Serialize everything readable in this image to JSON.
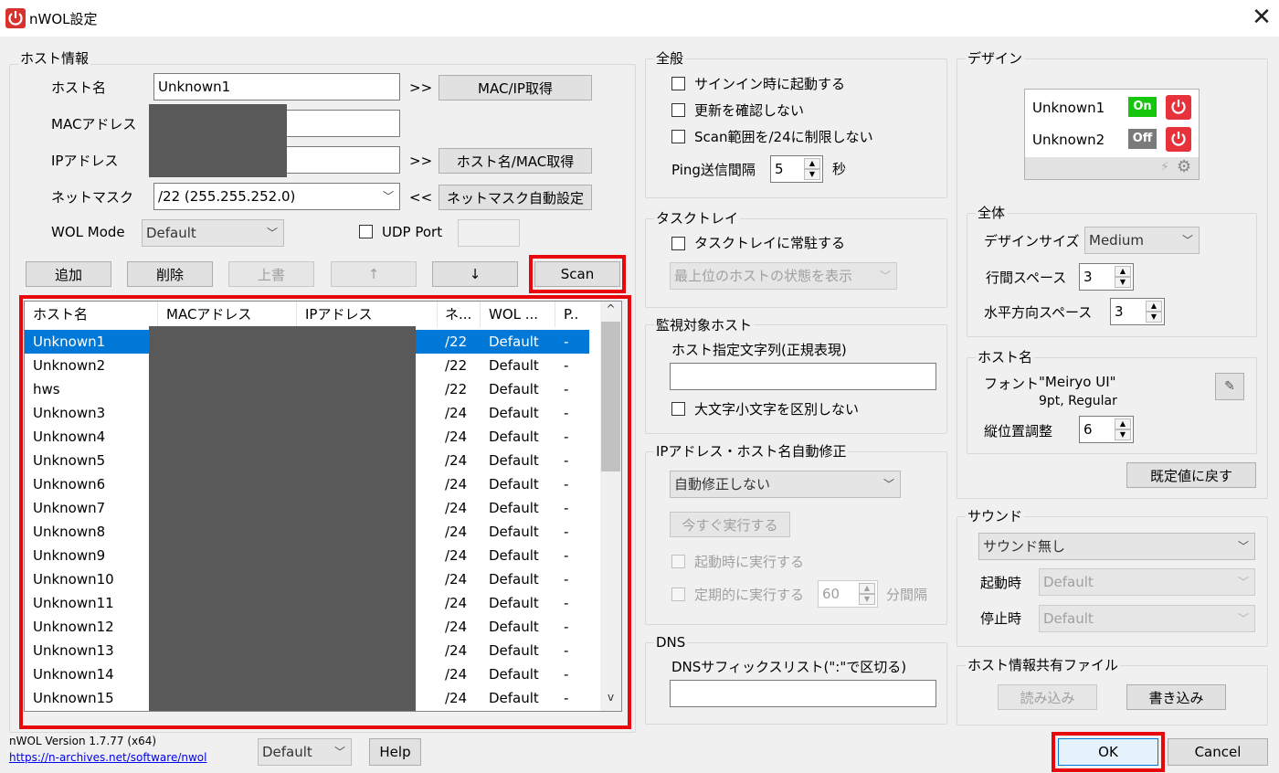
{
  "window": {
    "title": "nWOL設定",
    "close_icon": "close-icon"
  },
  "host_info": {
    "group_label": "ホスト情報",
    "hostname_label": "ホスト名",
    "hostname_value": "Unknown1",
    "arrow1": ">>",
    "mac_ip_button": "MAC/IP取得",
    "mac_label": "MACアドレス",
    "ip_label": "IPアドレス",
    "arrow2": ">>",
    "host_mac_button": "ホスト名/MAC取得",
    "netmask_label": "ネットマスク",
    "netmask_value": "/22 (255.255.252.0)",
    "arrow3": "<<",
    "netmask_auto_button": "ネットマスク自動設定",
    "wol_mode_label": "WOL Mode",
    "wol_mode_value": "Default",
    "udp_port_label": "UDP Port",
    "add_button": "追加",
    "delete_button": "削除",
    "overwrite_button": "上書",
    "up_button": "↑",
    "down_button": "↓",
    "scan_button": "Scan"
  },
  "host_list": {
    "columns": [
      "ホスト名",
      "MACアドレス",
      "IPアドレス",
      "ネ...",
      "WOL ...",
      "P.."
    ],
    "rows": [
      {
        "name": "Unknown1",
        "mask": "/22",
        "wol": "Default",
        "p": "-"
      },
      {
        "name": "Unknown2",
        "mask": "/22",
        "wol": "Default",
        "p": "-"
      },
      {
        "name": "hws",
        "mask": "/22",
        "wol": "Default",
        "p": "-"
      },
      {
        "name": "Unknown3",
        "mask": "/24",
        "wol": "Default",
        "p": "-"
      },
      {
        "name": "Unknown4",
        "mask": "/24",
        "wol": "Default",
        "p": "-"
      },
      {
        "name": "Unknown5",
        "mask": "/24",
        "wol": "Default",
        "p": "-"
      },
      {
        "name": "Unknown6",
        "mask": "/24",
        "wol": "Default",
        "p": "-"
      },
      {
        "name": "Unknown7",
        "mask": "/24",
        "wol": "Default",
        "p": "-"
      },
      {
        "name": "Unknown8",
        "mask": "/24",
        "wol": "Default",
        "p": "-"
      },
      {
        "name": "Unknown9",
        "mask": "/24",
        "wol": "Default",
        "p": "-"
      },
      {
        "name": "Unknown10",
        "mask": "/24",
        "wol": "Default",
        "p": "-"
      },
      {
        "name": "Unknown11",
        "mask": "/24",
        "wol": "Default",
        "p": "-"
      },
      {
        "name": "Unknown12",
        "mask": "/24",
        "wol": "Default",
        "p": "-"
      },
      {
        "name": "Unknown13",
        "mask": "/24",
        "wol": "Default",
        "p": "-"
      },
      {
        "name": "Unknown14",
        "mask": "/24",
        "wol": "Default",
        "p": "-"
      },
      {
        "name": "Unknown15",
        "mask": "/24",
        "wol": "Default",
        "p": "-"
      }
    ],
    "selected_index": 0,
    "scroll_up_icon": "^",
    "scroll_down_icon": "v"
  },
  "footer": {
    "version": "nWOL Version 1.7.77 (x64)",
    "url": "https://n-archives.net/software/nwol",
    "theme_value": "Default",
    "help_button": "Help",
    "ok_button": "OK",
    "cancel_button": "Cancel"
  },
  "general": {
    "group_label": "全般",
    "startup_label": "サインイン時に起動する",
    "no_update_label": "更新を確認しない",
    "scan_range_label": "Scan範囲を/24に制限しない",
    "ping_label": "Ping送信間隔",
    "ping_value": "5",
    "ping_unit": "秒"
  },
  "tray": {
    "group_label": "タスクトレイ",
    "resident_label": "タスクトレイに常駐する",
    "display_value": "最上位のホストの状態を表示"
  },
  "monitor": {
    "group_label": "監視対象ホスト",
    "pattern_label": "ホスト指定文字列(正規表現)",
    "pattern_value": "",
    "ignore_case_label": "大文字小文字を区別しない"
  },
  "autofix": {
    "group_label": "IPアドレス・ホスト名自動修正",
    "mode_value": "自動修正しない",
    "run_now_button": "今すぐ実行する",
    "run_at_start_label": "起動時に実行する",
    "periodic_label": "定期的に実行する",
    "interval_value": "60",
    "interval_unit": "分間隔"
  },
  "dns": {
    "group_label": "DNS",
    "suffix_label": "DNSサフィックスリスト(\":\"で区切る)",
    "suffix_value": ""
  },
  "design": {
    "group_label": "デザイン",
    "preview": [
      {
        "name": "Unknown1",
        "state": "On",
        "state_color": "#16c60c"
      },
      {
        "name": "Unknown2",
        "state": "Off",
        "state_color": "#7a7a7a"
      }
    ],
    "power_color": "#e8323b"
  },
  "overall": {
    "group_label": "全体",
    "size_label": "デザインサイズ",
    "size_value": "Medium",
    "line_space_label": "行間スペース",
    "line_space_value": "3",
    "h_space_label": "水平方向スペース",
    "h_space_value": "3"
  },
  "hostname_style": {
    "group_label": "ホスト名",
    "font_label": "フォント",
    "font_value": "\"Meiryo UI\"",
    "font_detail": "9pt, Regular",
    "vpos_label": "縦位置調整",
    "vpos_value": "6",
    "reset_button": "既定値に戻す"
  },
  "sound": {
    "group_label": "サウンド",
    "sound_value": "サウンド無し",
    "start_label": "起動時",
    "start_value": "Default",
    "stop_label": "停止時",
    "stop_value": "Default"
  },
  "share": {
    "group_label": "ホスト情報共有ファイル",
    "read_button": "読み込み",
    "write_button": "書き込み"
  },
  "colors": {
    "highlight": "#e8070d",
    "selection": "#0078d7"
  }
}
